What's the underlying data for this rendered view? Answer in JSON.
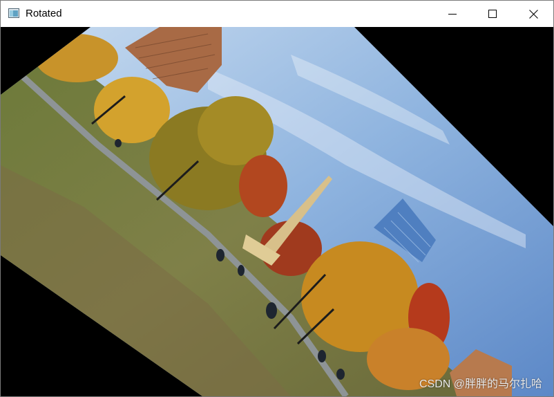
{
  "window": {
    "title": "Rotated",
    "icon": "app-window-icon"
  },
  "controls": {
    "minimize_icon": "minimize-icon",
    "maximize_icon": "maximize-icon",
    "close_icon": "close-icon"
  },
  "image": {
    "description_icon": "rotated-park-photo",
    "watermark": "CSDN @胖胖的马尔扎哈"
  },
  "colors": {
    "background": "#000000",
    "titlebar": "#ffffff"
  }
}
